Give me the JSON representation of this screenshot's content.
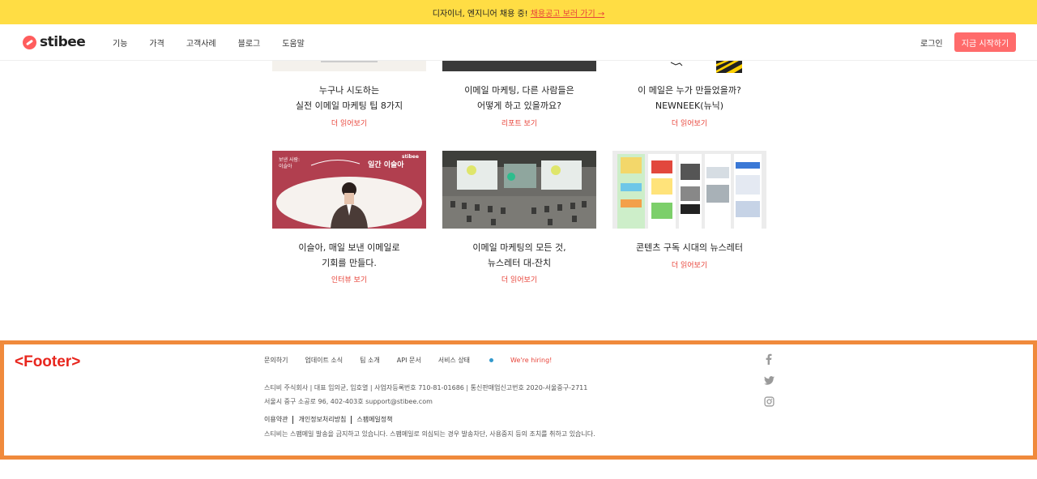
{
  "announcement": {
    "text": "디자이너, 엔지니어 채용 중!",
    "link": "채용공고 보러 가기 →"
  },
  "header": {
    "logo": "stibee",
    "nav": [
      "기능",
      "가격",
      "고객사례",
      "블로그",
      "도움말"
    ],
    "login": "로그인",
    "cta": "지금 시작하기"
  },
  "cards": [
    {
      "title_1": "누구나 시도하는",
      "title_2": "실전 이메일 마케팅 팁 8가지",
      "link": "더 읽어보기"
    },
    {
      "title_1": "이메일 마케팅, 다른 사람들은",
      "title_2": "어떻게 하고 있을까요?",
      "link": "리포트 보기"
    },
    {
      "title_1": "이 메일은 누가 만들었을까?",
      "title_2": "NEWNEEK(뉴닉)",
      "link": "더 읽어보기"
    },
    {
      "title_1": "이슬아, 매일 보낸 이메일로",
      "title_2": "기회를 만들다.",
      "link": "인터뷰 보기",
      "thumb_text_1": "보낸 사람:",
      "thumb_text_2": "이슬아",
      "thumb_title": "일간 이슬아",
      "thumb_brand": "stibee"
    },
    {
      "title_1": "이메일 마케팅의 모든 것,",
      "title_2": "뉴스레터 대-잔치",
      "link": "더 읽어보기"
    },
    {
      "title_1": "콘텐츠 구독 시대의 뉴스레터",
      "title_2": "",
      "link": "더 읽어보기"
    }
  ],
  "footer": {
    "label": "<Footer>",
    "links": [
      "문의하기",
      "업데이트 소식",
      "팀 소개",
      "API 문서",
      "서비스 상태"
    ],
    "hiring": "We're hiring!",
    "company": "스티비 주식회사 | 대표 임의균, 임호열 | 사업자등록번호 710-81-01686 | 통신판매업신고번호 2020-서울중구-2711",
    "address": "서울시 중구 소공로 96, 402-403호 support@stibee.com",
    "policies": [
      "이용약관",
      "개인정보처리방침",
      "스팸메일정책"
    ],
    "spam_notice": "스티비는 스팸메일 발송을 금지하고 있습니다. 스팸메일로 의심되는 경우 발송차단, 사용중지 등의 조치를 취하고 있습니다."
  },
  "colors": {
    "accent": "#ff6b6b",
    "announce_bg": "#ffdd44",
    "footer_border": "#f08a3c",
    "link": "#e8443a"
  }
}
